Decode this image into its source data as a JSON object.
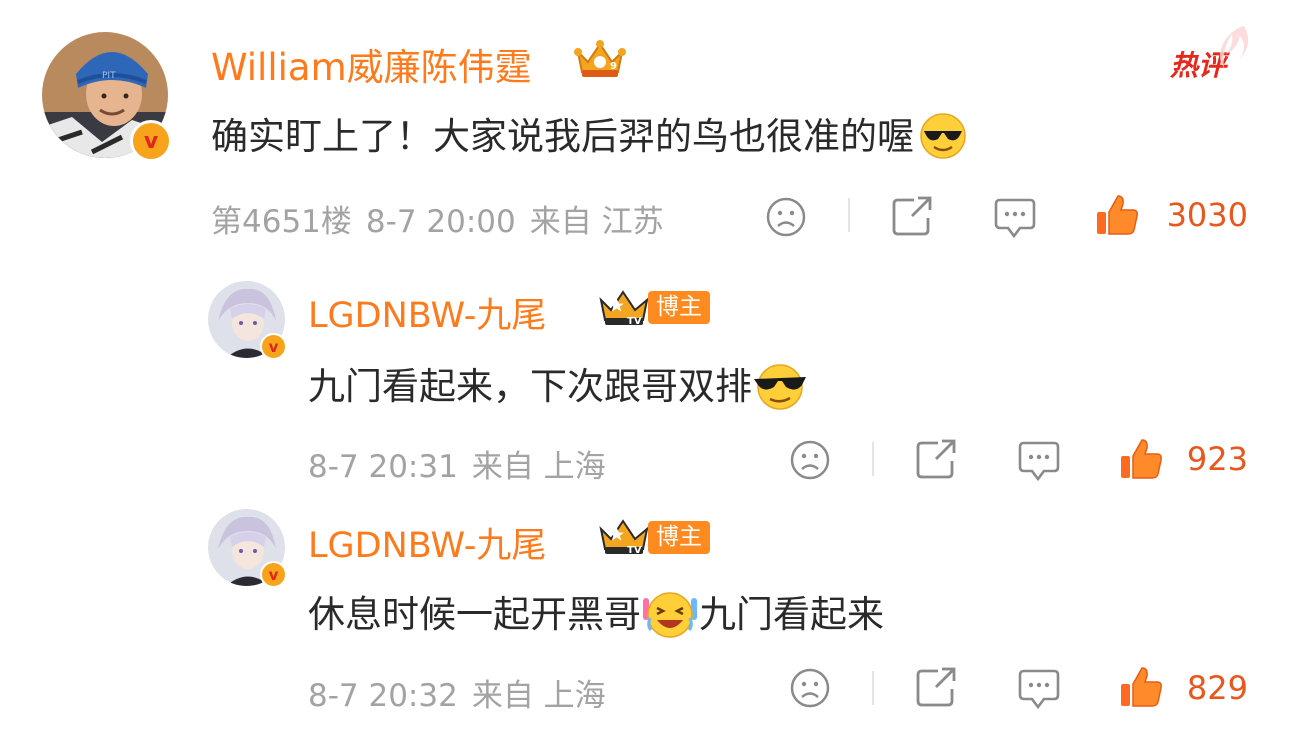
{
  "main_comment": {
    "username": "William威廉陈伟霆",
    "hot_label": "热评",
    "text": "确实盯上了！大家说我后羿的鸟也很准的喔",
    "floor": "第4651楼",
    "time": "8-7 20:00",
    "location": "来自 江苏",
    "likes": "3030",
    "verified_badge": "v"
  },
  "replies": [
    {
      "username": "LGDNBW-九尾",
      "role_tag": "博主",
      "text_before": "九门看起来，下次跟哥双排",
      "text_after": "",
      "time": "8-7 20:31",
      "location": "来自 上海",
      "likes": "923",
      "verified_badge": "v"
    },
    {
      "username": "LGDNBW-九尾",
      "role_tag": "博主",
      "text_before": "休息时候一起开黑哥",
      "text_after": "九门看起来",
      "time": "8-7 20:32",
      "location": "来自 上海",
      "likes": "829",
      "verified_badge": "v"
    }
  ],
  "icons": [
    "sad-face-icon",
    "share-icon",
    "comment-icon",
    "thumbs-up-icon",
    "crown-badge-icon",
    "sunglasses-emoji-icon",
    "laughing-emoji-icon"
  ],
  "colors": {
    "username": "#ff7a1a",
    "likes": "#e8571c",
    "meta": "#a3a3a3",
    "hot": "#e8271c",
    "text": "#2a2a2a"
  }
}
